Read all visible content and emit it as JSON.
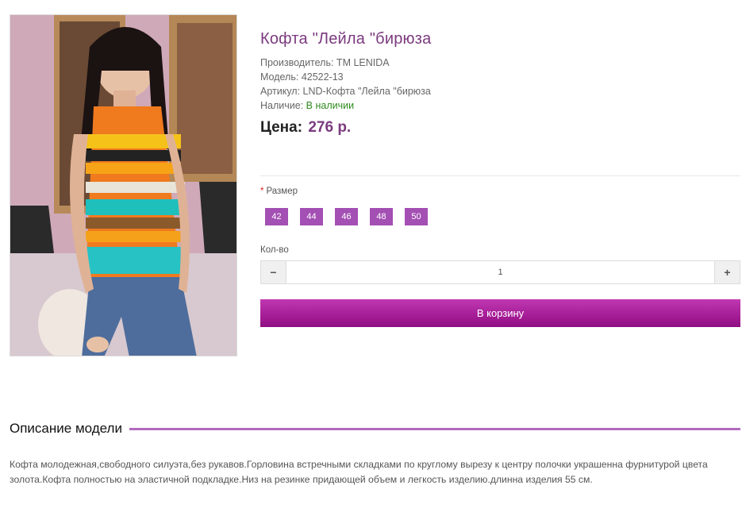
{
  "product": {
    "title": "Кофта \"Лейла \"бирюза",
    "manufacturer": "Производитель: TM LENIDA",
    "model": "Модель: 42522-13",
    "sku": "Артикул: LND-Кофта \"Лейла \"бирюза",
    "availability_label": "Наличие:",
    "availability_value": "В наличии",
    "price_label": "Цена:",
    "price_value": "276 р."
  },
  "options": {
    "size_required_mark": "*",
    "size_label": "Размер",
    "sizes": [
      "42",
      "44",
      "46",
      "48",
      "50"
    ],
    "qty_label": "Кол-во",
    "qty_value": "1",
    "qty_minus": "−",
    "qty_plus": "+"
  },
  "cart_button": "В корзину",
  "description": {
    "heading": "Описание модели",
    "text": "Кофта молодежная,свободного силуэта,без рукавов.Горловина встречными складками по круглому вырезу к центру полочки украшенна фурнитурой цвета золота.Кофта полностью на эластичной подкладке.Низ на резинке придающей объем и легкость изделию.длинна изделия 55 см."
  },
  "colors": {
    "accent": "#7b3a7e",
    "size_button": "#a34fb3",
    "cart_button": "#a51d96",
    "in_stock": "#2f8a1f"
  }
}
